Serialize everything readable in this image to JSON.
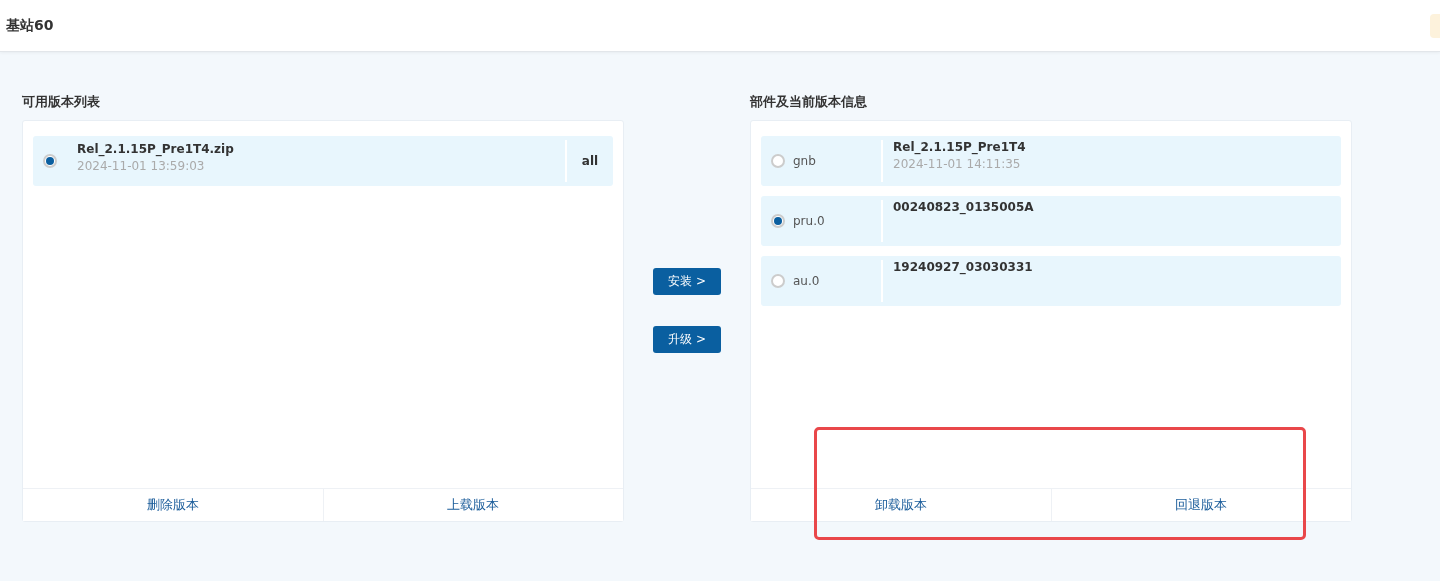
{
  "header": {
    "title": "基站60"
  },
  "available_versions": {
    "title": "可用版本列表",
    "items": [
      {
        "name": "Rel_2.1.15P_Pre1T4.zip",
        "time": "2024-11-01 13:59:03",
        "scope": "all",
        "selected": true
      }
    ],
    "actions": [
      "删除版本",
      "上载版本"
    ]
  },
  "transfer_buttons": [
    "安装 >",
    "升级 >"
  ],
  "components": {
    "title": "部件及当前版本信息",
    "items": [
      {
        "name": "gnb",
        "version": "Rel_2.1.15P_Pre1T4",
        "time": "2024-11-01 14:11:35",
        "selected": false
      },
      {
        "name": "pru.0",
        "version": "00240823_0135005A",
        "selected": true
      },
      {
        "name": "au.0",
        "version": "19240927_03030331",
        "selected": false
      }
    ],
    "actions": [
      "卸载版本",
      "回退版本"
    ]
  },
  "highlight_box": true
}
